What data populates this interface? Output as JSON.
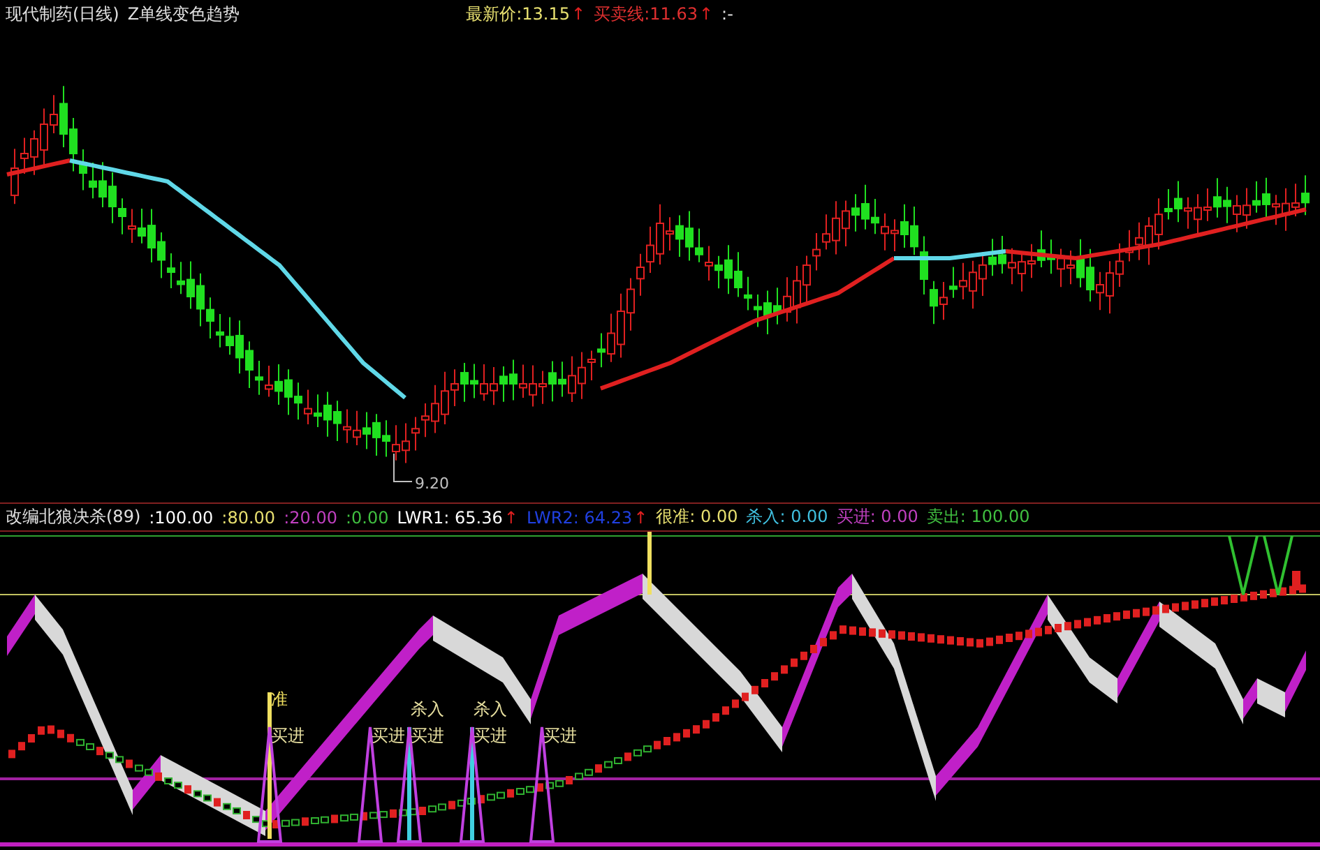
{
  "main_panel": {
    "title": "现代制药(日线)",
    "indicator": "Z单线变色趋势",
    "quotes": [
      {
        "label": "最新价:",
        "value": "13.15",
        "arrow": "↑",
        "color": "#e8e070"
      },
      {
        "label": "买卖线:",
        "value": "11.63",
        "arrow": "↑",
        "color": "#e03030"
      }
    ],
    "tail": ":-",
    "low_label": "9.20"
  },
  "sub_panel": {
    "title": "改编北狼决杀(89)",
    "levels": [
      {
        "value": ":100.00",
        "color": "#ffffff"
      },
      {
        "value": ":80.00",
        "color": "#e8e070"
      },
      {
        "value": ":20.00",
        "color": "#c040c0"
      },
      {
        "value": ":0.00",
        "color": "#40c040"
      }
    ],
    "readouts": [
      {
        "label": "LWR1:",
        "value": "65.36",
        "arrow": "↑",
        "color": "#ffffff"
      },
      {
        "label": "LWR2:",
        "value": "64.23",
        "arrow": "↑",
        "color": "#2040e0"
      },
      {
        "label": "很准:",
        "value": "0.00",
        "color": "#e8e070"
      },
      {
        "label": "杀入:",
        "value": "0.00",
        "color": "#40c0e0"
      },
      {
        "label": "买进:",
        "value": "0.00",
        "color": "#c040c0"
      },
      {
        "label": "卖出:",
        "value": "100.00",
        "color": "#40c040"
      }
    ]
  },
  "signals": [
    {
      "text": "准",
      "kind": "strong"
    },
    {
      "text": "买进",
      "kind": "buy"
    },
    {
      "text": "买进",
      "kind": "buy"
    },
    {
      "text": "杀入",
      "kind": "kill"
    },
    {
      "text": "买进",
      "kind": "buy"
    },
    {
      "text": "杀入",
      "kind": "kill"
    },
    {
      "text": "买进",
      "kind": "buy"
    },
    {
      "text": "买进",
      "kind": "buy"
    }
  ]
}
